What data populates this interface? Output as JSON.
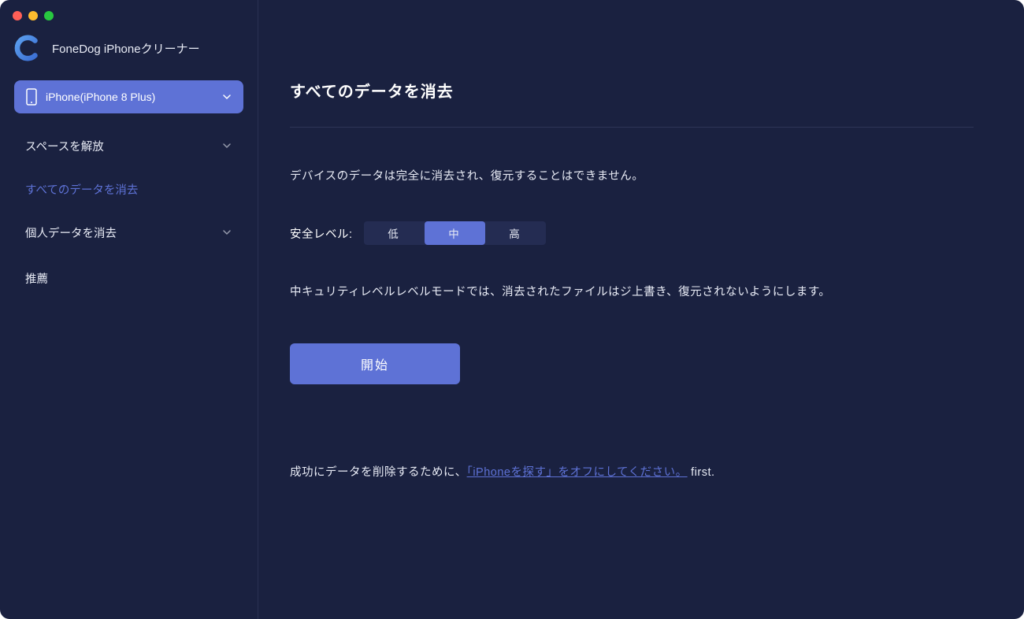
{
  "app": {
    "name": "FoneDog iPhoneクリーナー"
  },
  "device": {
    "label": "iPhone(iPhone 8 Plus)"
  },
  "sidebar": {
    "items": [
      {
        "label": "スペースを解放",
        "has_chevron": true
      },
      {
        "label": "すべてのデータを消去",
        "active": true
      },
      {
        "label": "個人データを消去",
        "has_chevron": true
      },
      {
        "label": "推薦",
        "has_chevron": false
      }
    ]
  },
  "main": {
    "title": "すべてのデータを消去",
    "warning": "デバイスのデータは完全に消去され、復元することはできません。",
    "security_label": "安全レベル:",
    "security_options": {
      "low": "低",
      "medium": "中",
      "high": "高"
    },
    "security_selected": "medium",
    "security_description": "中キュリティレベルレベルモードでは、消去されたファイルはジ上書き、復元されないようにします。",
    "start_button": "開始",
    "bottom_note": {
      "prefix": "成功にデータを削除するために、",
      "link": "「iPhoneを探す」をオフにしてください。",
      "suffix": " first."
    }
  }
}
